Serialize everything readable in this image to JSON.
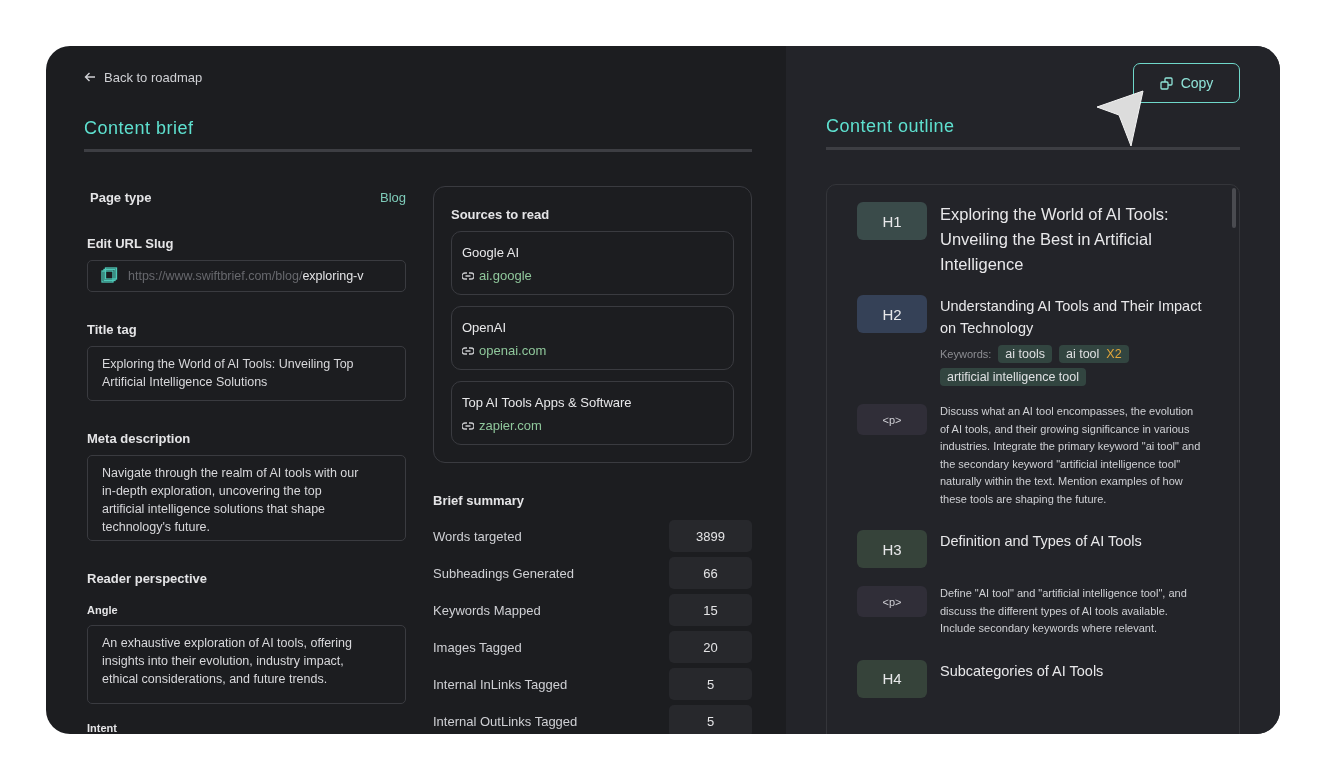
{
  "back_link": "Back to roadmap",
  "brief": {
    "title": "Content brief",
    "page_type": {
      "label": "Page type",
      "value": "Blog"
    },
    "url_slug": {
      "label": "Edit URL Slug",
      "prefix": "https://www.swiftbrief.com/blog/",
      "value": "exploring-v"
    },
    "title_tag": {
      "label": "Title tag",
      "value": "Exploring the World of AI Tools: Unveiling Top Artificial Intelligence Solutions"
    },
    "meta_description": {
      "label": "Meta description",
      "value": "Navigate through the realm of AI tools with our in-depth exploration, uncovering the top artificial intelligence solutions that shape technology's future."
    },
    "reader_perspective": {
      "title": "Reader perspective",
      "angle": {
        "label": "Angle",
        "value": "An exhaustive exploration of AI tools, offering insights into their evolution, industry impact, ethical considerations, and future trends."
      },
      "intent": {
        "label": "Intent"
      }
    }
  },
  "sources": {
    "title": "Sources to read",
    "items": [
      {
        "name": "Google AI",
        "domain": "ai.google"
      },
      {
        "name": "OpenAI",
        "domain": "openai.com"
      },
      {
        "name": "Top AI Tools Apps & Software",
        "domain": "zapier.com"
      }
    ]
  },
  "summary": {
    "title": "Brief summary",
    "rows": [
      {
        "label": "Words targeted",
        "value": "3899"
      },
      {
        "label": "Subheadings Generated",
        "value": "66"
      },
      {
        "label": "Keywords Mapped",
        "value": "15"
      },
      {
        "label": "Images Tagged",
        "value": "20"
      },
      {
        "label": "Internal InLinks Tagged",
        "value": "5"
      },
      {
        "label": "Internal OutLinks Tagged",
        "value": "5"
      }
    ]
  },
  "outline": {
    "title": "Content outline",
    "copy_button": "Copy",
    "items": [
      {
        "kind": "heading",
        "tag": "H1",
        "color": "#3a4b4a",
        "text": "Exploring the World of AI Tools: Unveiling the Best in Artificial Intelligence"
      },
      {
        "kind": "heading",
        "tag": "H2",
        "color": "#354157",
        "text": "Understanding AI Tools and Their Impact on Technology",
        "keywords_label": "Keywords:",
        "keywords": [
          {
            "text": "ai tools"
          },
          {
            "text": "ai tool",
            "count": "X2"
          },
          {
            "text": "artificial intelligence tool"
          }
        ]
      },
      {
        "kind": "paragraph",
        "tag": "<p>",
        "color": "#302e38",
        "text": "Discuss what an AI tool encompasses, the evolution of AI tools, and their growing significance in various industries. Integrate the primary keyword \"ai tool\" and the secondary keyword \"artificial intelligence tool\" naturally within the text. Mention examples of how these tools are shaping the future."
      },
      {
        "kind": "heading",
        "tag": "H3",
        "color": "#36433a",
        "text": "Definition and Types of AI Tools"
      },
      {
        "kind": "paragraph",
        "tag": "<p>",
        "color": "#302e38",
        "text": "Define \"AI tool\" and \"artificial intelligence tool\", and discuss the different types of AI tools available. Include secondary keywords where relevant."
      },
      {
        "kind": "heading",
        "tag": "H4",
        "color": "#36433a",
        "text": "Subcategories of AI Tools"
      }
    ]
  }
}
